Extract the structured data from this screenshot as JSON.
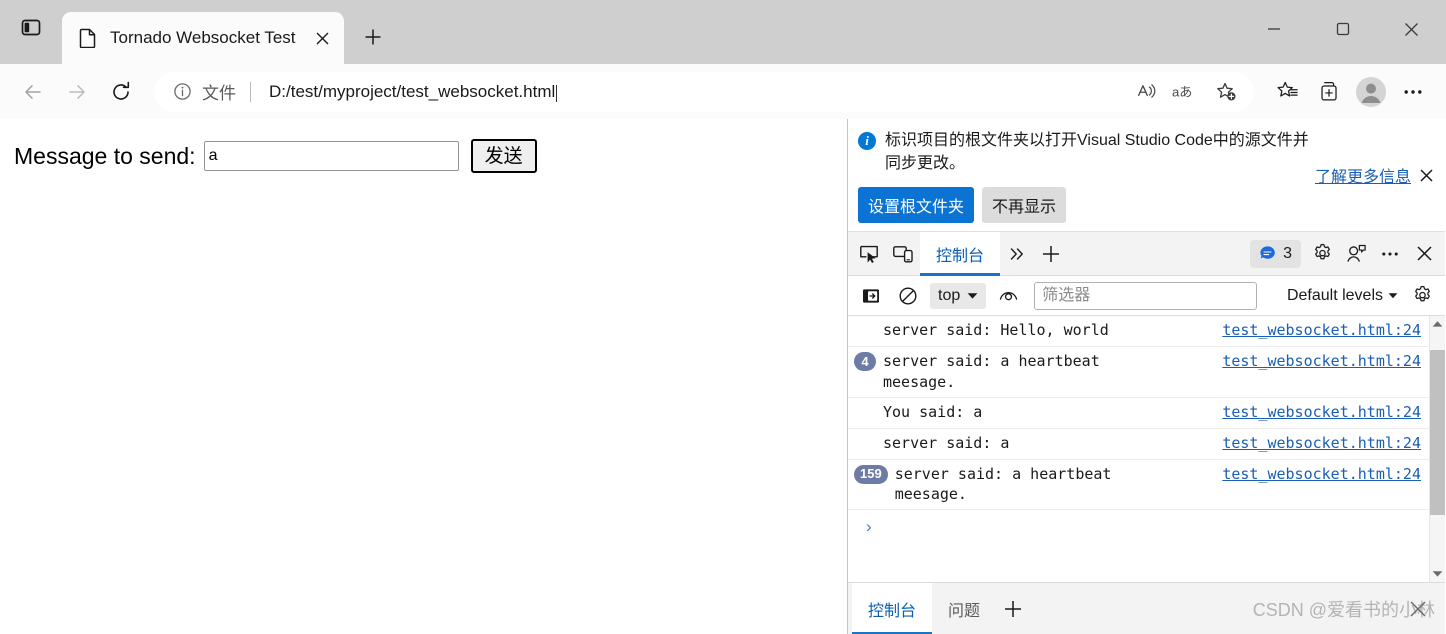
{
  "browser": {
    "tab": {
      "title": "Tornado Websocket Test",
      "favicon_icon": "document-icon",
      "close_icon": "close-icon"
    },
    "tab_actions_icon": "split-panel-icon",
    "new_tab_label": "+",
    "window_controls": {
      "minimize": "minimize-icon",
      "maximize": "maximize-icon",
      "close": "close-icon"
    },
    "nav": {
      "back_icon": "arrow-left-icon",
      "forward_icon": "arrow-right-icon",
      "reload_icon": "reload-icon"
    },
    "omnibox": {
      "info_icon": "info-circle-icon",
      "scheme_label": "文件",
      "url": "D:/test/myproject/test_websocket.html",
      "read_aloud_icon": "read-aloud-icon",
      "translate_icon": "translate-icon",
      "add_favorite_icon": "star-plus-icon"
    },
    "toolbar_right": {
      "favorites_icon": "favorites-star-list-icon",
      "collections_icon": "collections-icon",
      "profile_icon": "profile-avatar-icon",
      "more_icon": "ellipsis-icon"
    }
  },
  "page": {
    "label": "Message to send:",
    "input_value": "a",
    "input_placeholder": "",
    "send_button": "发送"
  },
  "devtools": {
    "banner": {
      "info_icon": "info-circle-icon",
      "text": "标识项目的根文件夹以打开Visual Studio Code中的源文件并同步更改。",
      "learn_more": "了解更多信息",
      "close_icon": "close-icon",
      "primary_button": "设置根文件夹",
      "secondary_button": "不再显示"
    },
    "tabbar": {
      "inspect_icon": "inspect-element-icon",
      "device_toggle_icon": "device-emulation-icon",
      "tabs": [
        {
          "label": "控制台",
          "active": true
        }
      ],
      "more_tabs_icon": "chevron-double-right-icon",
      "add_tab_icon": "plus-icon",
      "message_badge": {
        "icon": "speech-bubble-icon",
        "count": "3"
      },
      "settings_icon": "gear-icon",
      "feedback_icon": "feedback-icon",
      "more_icon": "ellipsis-icon",
      "close_icon": "close-icon"
    },
    "filterbar": {
      "sidebar_toggle_icon": "console-sidebar-icon",
      "clear_console_icon": "clear-console-icon",
      "context": "top",
      "context_chevron_icon": "chevron-down-icon",
      "live_expression_icon": "eye-icon",
      "filter_placeholder": "筛选器",
      "filter_value": "",
      "levels_label": "Default levels",
      "levels_chevron_icon": "chevron-down-icon",
      "settings_icon": "gear-icon"
    },
    "console": {
      "messages": [
        {
          "repeat_count": "",
          "text": "server said: Hello, world",
          "source": "test_websocket.html:24"
        },
        {
          "repeat_count": "4",
          "text": "server said: a heartbeat\nmeesage.",
          "source": "test_websocket.html:24"
        },
        {
          "repeat_count": "",
          "text": "You said: a",
          "source": "test_websocket.html:24"
        },
        {
          "repeat_count": "",
          "text": "server said: a",
          "source": "test_websocket.html:24"
        },
        {
          "repeat_count": "159",
          "text": "server said: a heartbeat\nmeesage.",
          "source": "test_websocket.html:24"
        }
      ],
      "prompt_chevron": "›",
      "scrollbar": {
        "up_icon": "scroll-up-arrow-icon",
        "down_icon": "scroll-down-arrow-icon"
      }
    },
    "drawer": {
      "tabs": [
        {
          "label": "控制台",
          "active": true
        },
        {
          "label": "问题",
          "active": false
        }
      ],
      "add_tab_icon": "plus-icon",
      "close_icon": "close-icon"
    }
  },
  "watermark": "CSDN @爱看书的小林",
  "colors": {
    "accent_blue": "#0a73d4",
    "link_blue": "#1a5fb4",
    "tab_underline": "#1a73c8",
    "badge_blue_gray": "#6e7ba5",
    "window_chrome": "#cfcfcf"
  }
}
